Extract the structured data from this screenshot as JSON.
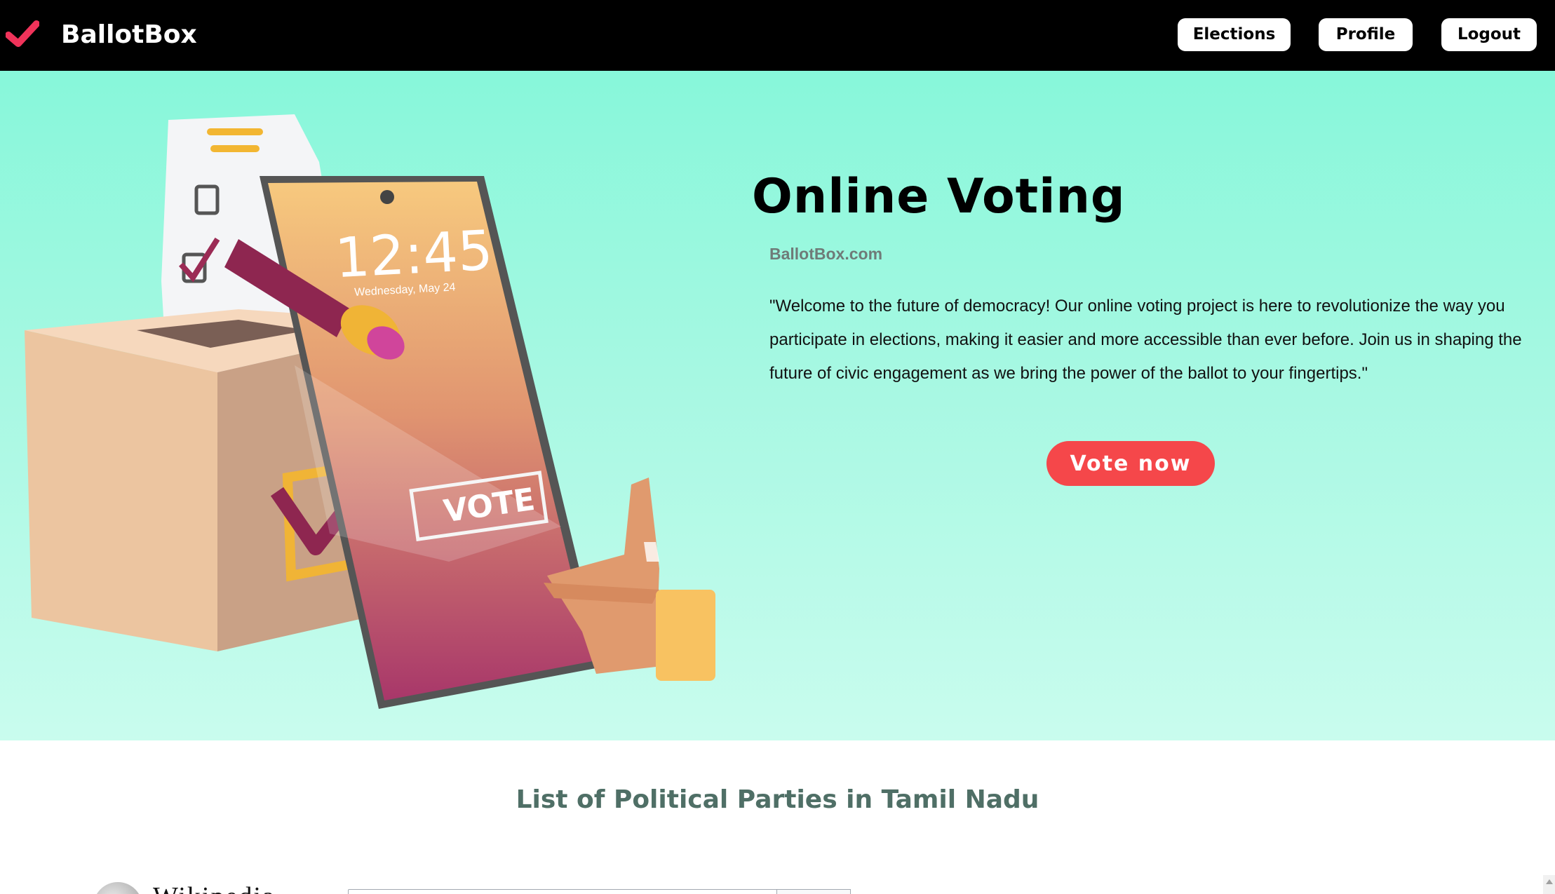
{
  "app": {
    "name": "BallotBox"
  },
  "nav": {
    "elections_label": "Elections",
    "profile_label": "Profile",
    "logout_label": "Logout"
  },
  "hero": {
    "title": "Online Voting",
    "site": "BallotBox.com",
    "description": "\"Welcome to the future of democracy! Our online voting project is here to revolutionize the way you participate in elections, making it easier and more accessible than ever before. Join us in shaping the future of civic engagement as we bring the power of the ballot to your fingertips.\"",
    "cta_label": "Vote now",
    "illustration": {
      "phone_time": "12:45",
      "phone_date": "Wednesday, May 24",
      "vote_label": "VOTE"
    }
  },
  "parties": {
    "title": "List of Political Parties in Tamil Nadu",
    "embed_wordmark": "Wikipedia"
  },
  "colors": {
    "navbar": "#000000",
    "accent": "#f5474a",
    "hero_top": "#87f7da",
    "hero_bottom": "#c9fcee",
    "section_title": "#4f6f66"
  },
  "icons": {
    "brand": "checkmark-icon",
    "scroll": "scroll-up-arrow-icon"
  }
}
